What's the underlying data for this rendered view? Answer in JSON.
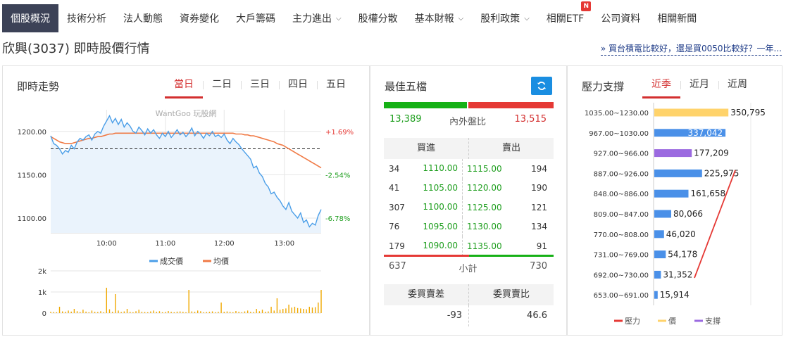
{
  "nav": {
    "items": [
      {
        "label": "個股概況",
        "active": true
      },
      {
        "label": "技術分析"
      },
      {
        "label": "法人動態"
      },
      {
        "label": "資券變化"
      },
      {
        "label": "大戶籌碼"
      },
      {
        "label": "主力進出",
        "dropdown": true
      },
      {
        "label": "股權分散"
      },
      {
        "label": "基本財報",
        "dropdown": true
      },
      {
        "label": "股利政策",
        "dropdown": true
      },
      {
        "label": "相關ETF",
        "badge": "N"
      },
      {
        "label": "公司資料"
      },
      {
        "label": "相關新聞"
      }
    ]
  },
  "page": {
    "title": "欣興(3037) 即時股價行情",
    "promo": "» 買台積電比較好，還是買0050比較好？一年..."
  },
  "intraday": {
    "title": "即時走勢",
    "tabs": [
      "當日",
      "二日",
      "三日",
      "四日",
      "五日"
    ],
    "active_tab": 0,
    "watermark": "WantGoo 玩股網",
    "legend": [
      "成交價",
      "均價"
    ],
    "colors": {
      "price": "#4a9ee8",
      "avg": "#f07a45",
      "volume": "#f0a800"
    }
  },
  "chart_data": {
    "type": "line",
    "x_ticks": [
      "10:00",
      "11:00",
      "12:00",
      "13:00"
    ],
    "y_ticks": [
      "1200.00",
      "1150.00",
      "1100.00"
    ],
    "ylim": [
      1083,
      1225
    ],
    "pct_labels": [
      "+1.69%",
      "-2.54%",
      "-6.78%"
    ],
    "reference_price": 1180,
    "volume_ticks": [
      "2k",
      "1k",
      "0"
    ],
    "volume_ylim": [
      0,
      2000
    ],
    "series": [
      {
        "name": "成交價",
        "values": [
          1195,
          1186,
          1184,
          1180,
          1174,
          1178,
          1176,
          1184,
          1180,
          1188,
          1192,
          1190,
          1194,
          1196,
          1190,
          1197,
          1200,
          1198,
          1206,
          1212,
          1218,
          1210,
          1215,
          1208,
          1214,
          1205,
          1210,
          1206,
          1200,
          1198,
          1205,
          1201,
          1196,
          1203,
          1198,
          1202,
          1196,
          1192,
          1198,
          1194,
          1200,
          1193,
          1197,
          1202,
          1196,
          1199,
          1194,
          1198,
          1204,
          1195,
          1200,
          1197,
          1192,
          1198,
          1195,
          1200,
          1194,
          1196,
          1193,
          1197,
          1190,
          1186,
          1192,
          1188,
          1185,
          1180,
          1176,
          1172,
          1168,
          1158,
          1160,
          1152,
          1148,
          1140,
          1136,
          1128,
          1130,
          1124,
          1120,
          1114,
          1110,
          1118,
          1108,
          1104,
          1100,
          1106,
          1095,
          1098,
          1090,
          1094,
          1092,
          1103,
          1110
        ]
      },
      {
        "name": "均價",
        "values": [
          1194,
          1192,
          1190,
          1188,
          1187,
          1186,
          1186,
          1186,
          1187,
          1188,
          1189,
          1190,
          1191,
          1192,
          1192,
          1193,
          1194,
          1194,
          1195,
          1196,
          1197,
          1197,
          1198,
          1198,
          1198,
          1198,
          1198,
          1198,
          1198,
          1198,
          1198,
          1198,
          1198,
          1198,
          1198,
          1198,
          1198,
          1198,
          1198,
          1198,
          1198,
          1198,
          1198,
          1198,
          1198,
          1198,
          1198,
          1198,
          1198,
          1198,
          1198,
          1198,
          1198,
          1198,
          1198,
          1198,
          1198,
          1198,
          1198,
          1198,
          1198,
          1198,
          1198,
          1197,
          1197,
          1197,
          1196,
          1196,
          1195,
          1195,
          1194,
          1193,
          1192,
          1191,
          1190,
          1189,
          1188,
          1186,
          1185,
          1184,
          1182,
          1180,
          1178,
          1176,
          1174,
          1172,
          1170,
          1168,
          1166,
          1164,
          1162,
          1160,
          1158
        ]
      }
    ],
    "volume": [
      60,
      50,
      40,
      300,
      80,
      60,
      120,
      70,
      200,
      90,
      50,
      160,
      70,
      40,
      120,
      60,
      50,
      90,
      40,
      1200,
      180,
      60,
      900,
      120,
      50,
      80,
      200,
      60,
      40,
      90,
      160,
      60,
      50,
      40,
      80,
      120,
      60,
      90,
      40,
      50,
      100,
      60,
      40,
      70,
      80,
      60,
      40,
      1100,
      80,
      60,
      120,
      90,
      40,
      50,
      60,
      80,
      40,
      60,
      500,
      60,
      80,
      60,
      40,
      100,
      60,
      40,
      80,
      120,
      60,
      50,
      200,
      90,
      160,
      60,
      80,
      300,
      120,
      700,
      160,
      200,
      220,
      400,
      260,
      300,
      240,
      220,
      200,
      180,
      300,
      260,
      280,
      500,
      1100
    ]
  },
  "best_five": {
    "title": "最佳五檔",
    "buy_total": "13,389",
    "label": "內外盤比",
    "sell_total": "13,515",
    "head": [
      "買進",
      "賣出"
    ],
    "rows": [
      {
        "bv": "34",
        "bp": "1110.00",
        "sp": "1115.00",
        "sv": "194"
      },
      {
        "bv": "41",
        "bp": "1105.00",
        "sp": "1120.00",
        "sv": "190"
      },
      {
        "bv": "307",
        "bp": "1100.00",
        "sp": "1125.00",
        "sv": "121"
      },
      {
        "bv": "76",
        "bp": "1095.00",
        "sp": "1130.00",
        "sv": "134"
      },
      {
        "bv": "179",
        "bp": "1090.00",
        "sp": "1135.00",
        "sv": "91"
      }
    ],
    "sum_buy": "637",
    "sum_label": "小計",
    "sum_sell": "730",
    "diff_head": [
      "委買賣差",
      "委買賣比"
    ],
    "diff_values": [
      "-93",
      "46.6"
    ]
  },
  "pressure": {
    "title": "壓力支撐",
    "tabs": [
      "近季",
      "近月",
      "近周"
    ],
    "active_tab": 0,
    "ranges": [
      "1035.00~1230.00",
      "967.00~1030.00",
      "927.00~966.00",
      "887.00~926.00",
      "848.00~886.00",
      "809.00~847.00",
      "770.00~808.00",
      "731.00~769.00",
      "692.00~730.00",
      "653.00~691.00"
    ],
    "values": [
      350795,
      337042,
      177209,
      225975,
      161658,
      80066,
      46020,
      54178,
      31352,
      15914
    ],
    "value_labels": [
      "350,795",
      "337,042",
      "177,209",
      "225,975",
      "161,658",
      "80,066",
      "46,020",
      "54,178",
      "31,352",
      "15,914"
    ],
    "bar_types": [
      "price",
      "normal",
      "support",
      "normal",
      "normal",
      "normal",
      "normal",
      "normal",
      "normal",
      "normal"
    ],
    "max_value": 400000,
    "legend": [
      "壓力",
      "價",
      "支撐"
    ],
    "colors": {
      "pressure": "#e53935",
      "price": "#ffd36b",
      "support": "#9b6ae0",
      "normal": "#4a90e8"
    }
  }
}
